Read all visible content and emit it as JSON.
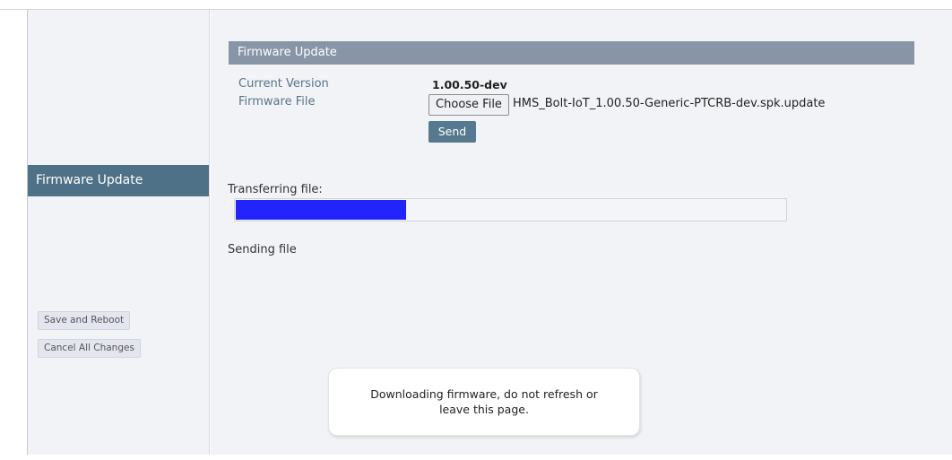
{
  "sidebar": {
    "active_item": "Firmware Update",
    "buttons": {
      "save_reboot": "Save and Reboot",
      "cancel_changes": "Cancel All Changes"
    }
  },
  "firmware": {
    "header": "Firmware Update",
    "current_version_label": "Current Version",
    "current_version_value": "1.00.50-dev",
    "firmware_file_label": "Firmware File",
    "choose_file_label": "Choose File",
    "selected_file": "HMS_Bolt-IoT_1.00.50-Generic-PTCRB-dev.spk.update",
    "send_label": "Send"
  },
  "transfer": {
    "label": "Transferring file:",
    "progress_fraction": 0.31,
    "progress_color": "#2323ff",
    "status": "Sending file"
  },
  "toast": {
    "message": "Downloading firmware, do not refresh or leave this page."
  },
  "colors": {
    "sidebar_active": "#4e7188",
    "section_header": "#8795a7",
    "send_button": "#56798f",
    "panel_bg": "#f1f3f6"
  }
}
